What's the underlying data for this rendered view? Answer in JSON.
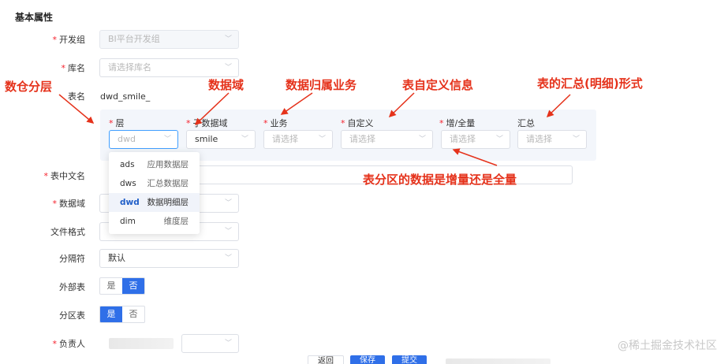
{
  "section_title": "基本属性",
  "form": {
    "dev_group": {
      "label": "开发组",
      "value": "BI平台开发组"
    },
    "db_name": {
      "label": "库名",
      "placeholder": "请选择库名"
    },
    "table_name": {
      "label": "表名",
      "value": "dwd_smile_"
    },
    "layer": {
      "label": "层",
      "value": "dwd"
    },
    "sub_domain": {
      "label": "子数据域",
      "value": "smile"
    },
    "business": {
      "label": "业务",
      "placeholder": "请选择"
    },
    "custom": {
      "label": "自定义",
      "placeholder": "请选择"
    },
    "incr_full": {
      "label": "增/全量",
      "placeholder": "请选择"
    },
    "summary": {
      "label": "汇总",
      "placeholder": "请选择"
    },
    "cn_name": {
      "label": "表中文名"
    },
    "data_domain": {
      "label": "数据域"
    },
    "file_format": {
      "label": "文件格式"
    },
    "separator": {
      "label": "分隔符",
      "value": "默认"
    },
    "external": {
      "label": "外部表",
      "yes": "是",
      "no": "否",
      "selected": "否"
    },
    "partition": {
      "label": "分区表",
      "yes": "是",
      "no": "否",
      "selected": "是"
    },
    "owner": {
      "label": "负责人"
    }
  },
  "layer_dropdown": [
    {
      "code": "ads",
      "desc": "应用数据层"
    },
    {
      "code": "dws",
      "desc": "汇总数据层"
    },
    {
      "code": "dwd",
      "desc": "数据明细层",
      "active": true
    },
    {
      "code": "dim",
      "desc": "维度层"
    }
  ],
  "annotations": {
    "a1": "数仓分层",
    "a2": "数据域",
    "a3": "数据归属业务",
    "a4": "表自定义信息",
    "a5": "表的汇总(明细)形式",
    "a6": "表分区的数据是增量还是全量"
  },
  "footer": {
    "back": "返回",
    "save": "保存",
    "submit": "提交"
  },
  "watermark": "@稀土掘金技术社区",
  "colors": {
    "required": "#f5222d",
    "primary": "#2f6fe8",
    "annotation": "#e5321b"
  }
}
